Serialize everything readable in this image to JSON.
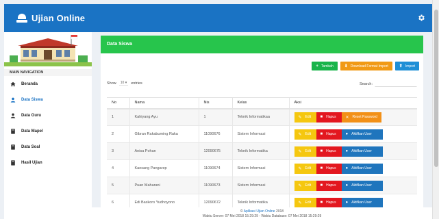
{
  "app": {
    "title": "Ujian Online"
  },
  "sidebar": {
    "nav_header": "MAIN NAVIGATION",
    "items": [
      {
        "label": "Beranda",
        "icon": "home-icon"
      },
      {
        "label": "Data Siswa",
        "icon": "user-icon",
        "active": true
      },
      {
        "label": "Data Guru",
        "icon": "user-icon"
      },
      {
        "label": "Data Mapel",
        "icon": "book-icon"
      },
      {
        "label": "Data Soal",
        "icon": "book-icon"
      },
      {
        "label": "Hasil Ujian",
        "icon": "book-icon"
      }
    ]
  },
  "panel": {
    "title": "Data Siswa",
    "toolbar": {
      "tambah": "Tambah",
      "download": "Download Format Import",
      "import": "Import"
    },
    "show_label": "Show",
    "show_value": "10",
    "entries_label": "entries",
    "search_label": "Search:",
    "search_value": ""
  },
  "table": {
    "headers": [
      "No",
      "Nama",
      "Nis",
      "Kelas",
      "Aksi"
    ],
    "rows": [
      {
        "no": "1",
        "nama": "Kahiyang Ayu",
        "nis": "1",
        "kelas": "Teknik Informatikaa",
        "third": "Reset Password"
      },
      {
        "no": "2",
        "nama": "Gibran Rakabuming Raka",
        "nis": "11090676",
        "kelas": "Sistem Informasi",
        "third": "Aktifkan User"
      },
      {
        "no": "3",
        "nama": "Anisa Pohan",
        "nis": "12090675",
        "kelas": "Teknik Informatika",
        "third": "Aktifkan User"
      },
      {
        "no": "4",
        "nama": "Kaesang Pangarep",
        "nis": "11090674",
        "kelas": "Sistem Informasi",
        "third": "Aktifkan User"
      },
      {
        "no": "5",
        "nama": "Puan Maharani",
        "nis": "11090673",
        "kelas": "Sistem Informasi",
        "third": "Aktifkan User"
      },
      {
        "no": "6",
        "nama": "Edi Baskoro Yudhoyono",
        "nis": "12090672",
        "kelas": "Teknik Informatika",
        "third": "Aktifkan User"
      }
    ],
    "edit_label": "Edit",
    "hapus_label": "Hapus"
  },
  "footer": {
    "prefix": "© ",
    "app_link": "Aplikasi Ujian Online",
    "year": " 2018",
    "server_line": "Waktu Server: 07 Mei 2018 15:29:29 - Waktu Database: 07 Mei 2018 15:29:29"
  },
  "colors": {
    "header": "#1a73c4",
    "panel_header": "#27c54c",
    "edit": "#f5c70f",
    "hapus": "#e3171f",
    "reset": "#f29017",
    "aktif": "#1f75bd"
  }
}
